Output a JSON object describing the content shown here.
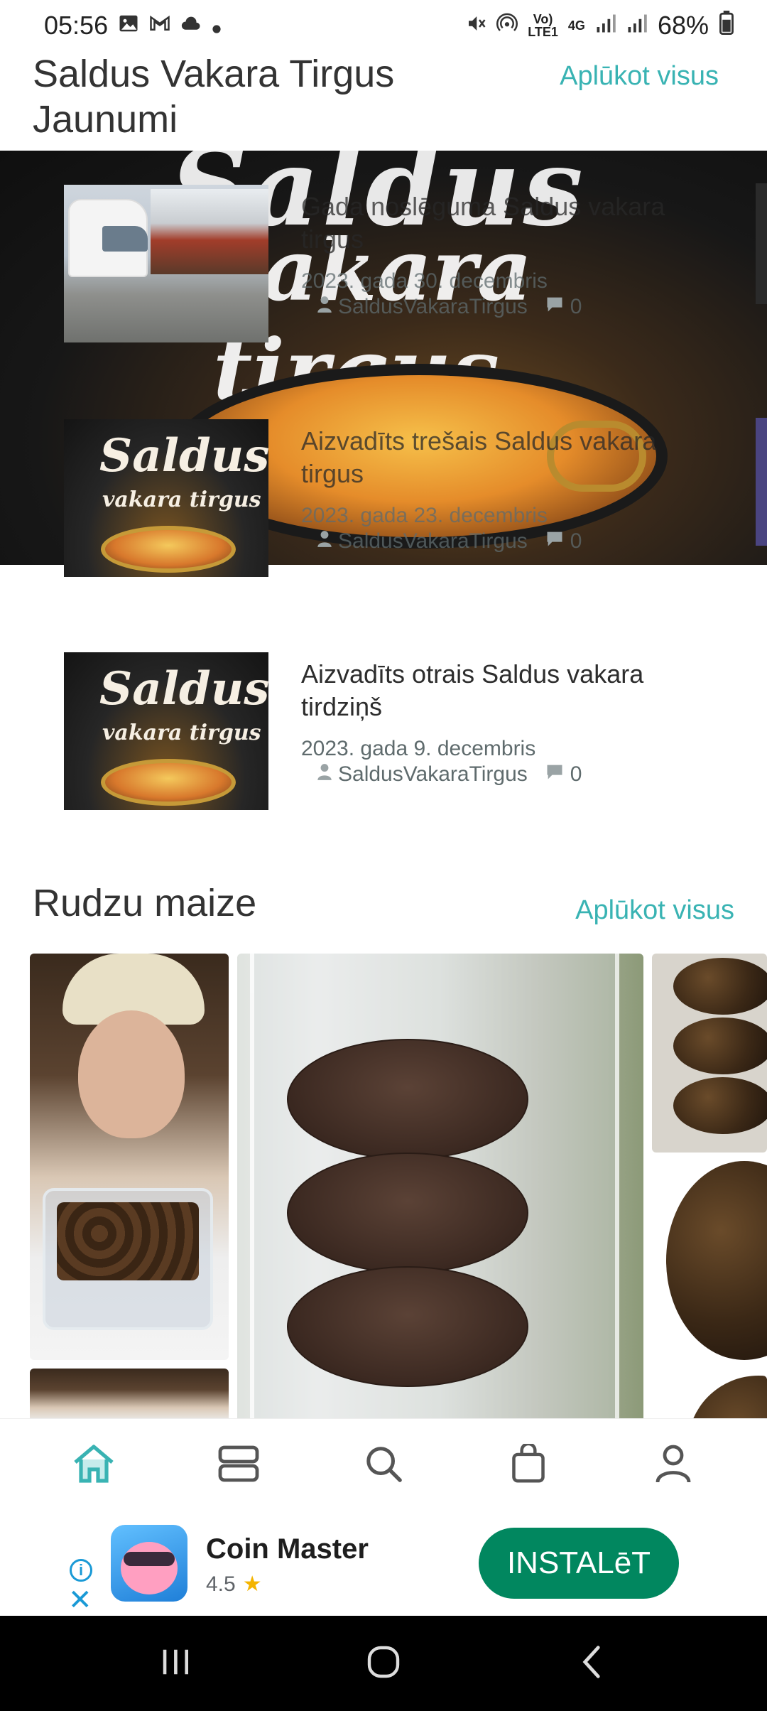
{
  "status_bar": {
    "time": "05:56",
    "volte": "Vo)",
    "lte": "LTE1",
    "network": "4G",
    "battery": "68%"
  },
  "header": {
    "title": "Saldus Vakara Tirgus Jaunumi",
    "view_all": "Aplūkot visus"
  },
  "news": [
    {
      "title": "Gada noslēguma Saldus vakara tirgus",
      "date": "2023. gada 30. decembris",
      "author": "SaldusVakaraTirgus",
      "comments": "0"
    },
    {
      "title": "Aizvadīts trešais Saldus vakara tirgus",
      "date": "2023. gada 23. decembris",
      "author": "SaldusVakaraTirgus",
      "comments": "0"
    },
    {
      "title": "Aizvadīts otrais Saldus vakara tirdziņš",
      "date": "2023. gada 9. decembris",
      "author": "SaldusVakaraTirgus",
      "comments": "0"
    }
  ],
  "hero_art": {
    "line1": "Saldus",
    "line2": "vakara tirgus"
  },
  "thumb_logo": {
    "line1": "Saldus",
    "line2": "vakara tirgus"
  },
  "section2": {
    "title": "Rudzu maize",
    "view_all": "Aplūkot visus"
  },
  "bottom_nav": [
    "home-icon",
    "list-icon",
    "search-icon",
    "bag-icon",
    "profile-icon"
  ],
  "ad": {
    "app_name": "Coin Master",
    "rating": "4.5",
    "install_label": "INSTALēT"
  },
  "colors": {
    "accent": "#39b3b3",
    "install": "#01875f",
    "ad_icon_blue": "#1a9ad6"
  }
}
